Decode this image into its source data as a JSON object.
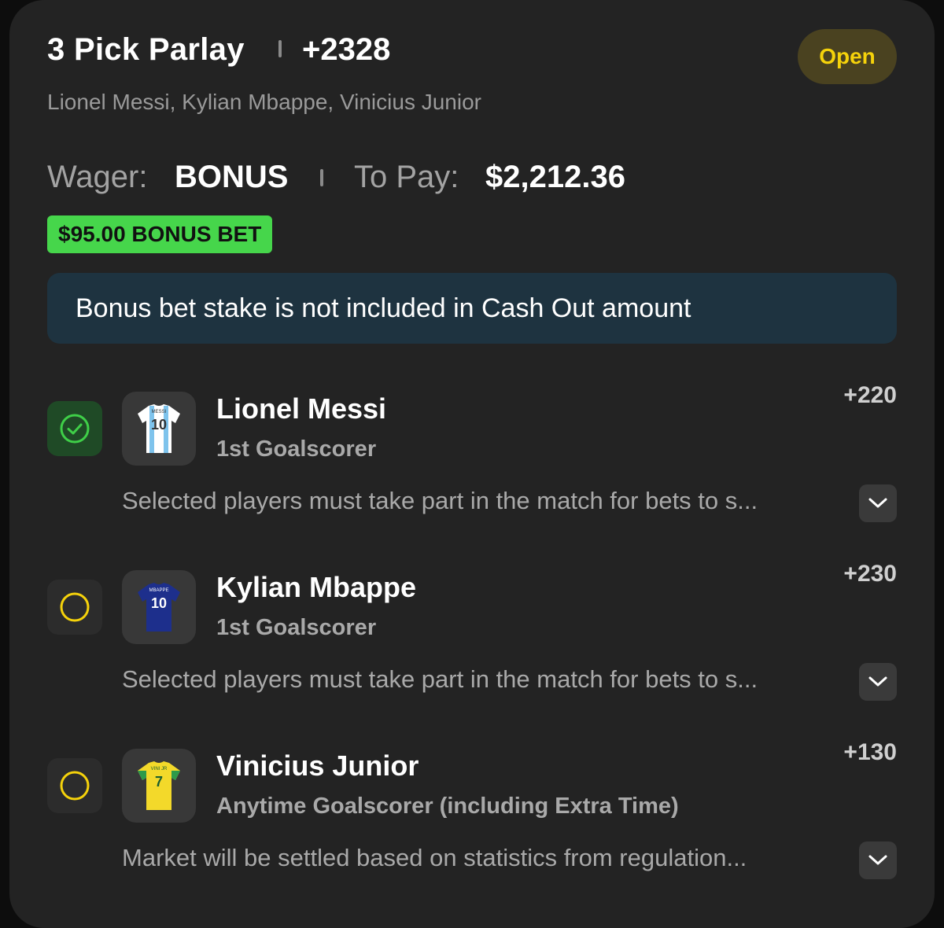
{
  "bet": {
    "title": "3 Pick Parlay",
    "odds": "+2328",
    "status": "Open",
    "players": "Lionel Messi, Kylian Mbappe, Vinicius Junior",
    "wager_label": "Wager:",
    "wager_value": "BONUS",
    "to_pay_label": "To Pay:",
    "to_pay_value": "$2,212.36",
    "bonus_badge": "$95.00 BONUS BET",
    "notice": "Bonus bet stake is not included in Cash Out amount"
  },
  "picks": [
    {
      "name": "Lionel Messi",
      "market": "1st Goalscorer",
      "odds": "+220",
      "note": "Selected players must take part in the match for bets to s...",
      "status": "won",
      "jersey_label": "MESSI",
      "jersey_number": "10"
    },
    {
      "name": "Kylian Mbappe",
      "market": "1st Goalscorer",
      "odds": "+230",
      "note": "Selected players must take part in the match for bets to s...",
      "status": "pending",
      "jersey_label": "MBAPPE",
      "jersey_number": "10"
    },
    {
      "name": "Vinicius Junior",
      "market": "Anytime Goalscorer (including Extra Time)",
      "odds": "+130",
      "note": "Market will be settled based on statistics from regulation...",
      "status": "pending",
      "jersey_label": "VINI JR",
      "jersey_number": "7"
    }
  ],
  "colors": {
    "status_open": "#f5d20b",
    "bonus_green": "#46d64b",
    "won_green": "#3fcf48",
    "pending_yellow": "#f5d20b"
  }
}
